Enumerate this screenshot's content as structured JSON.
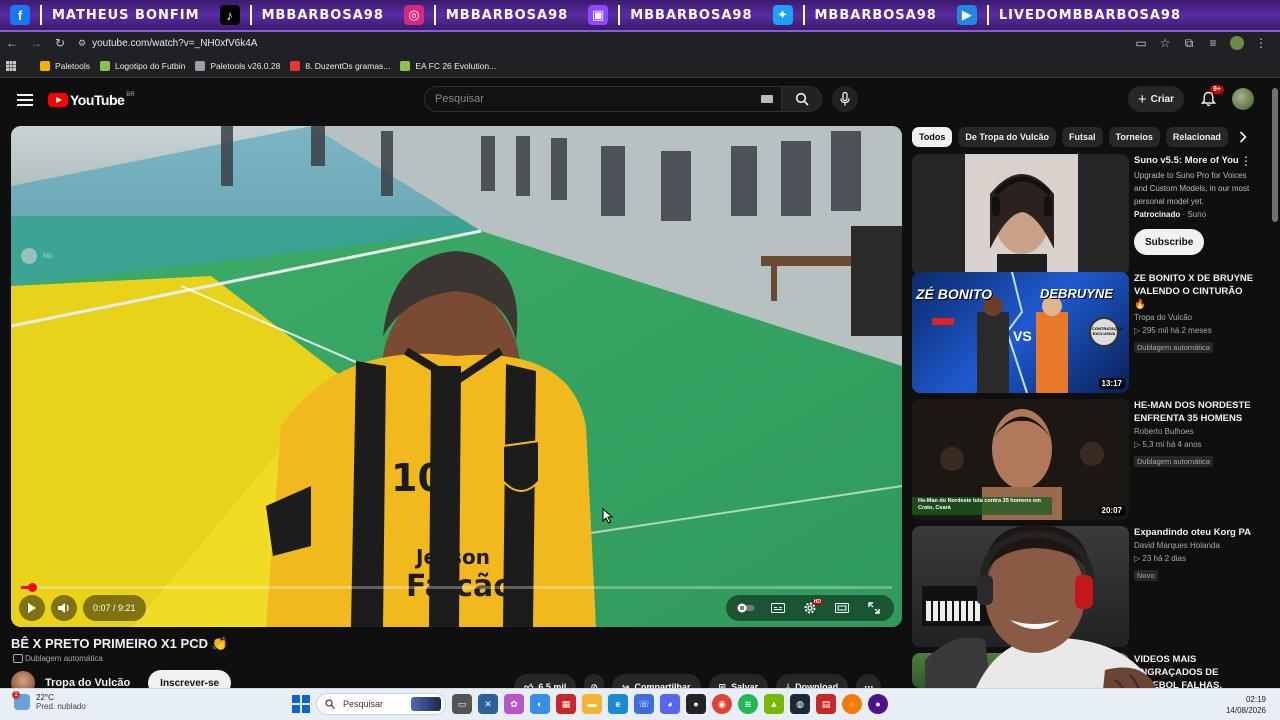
{
  "social": [
    {
      "icon": "facebook-icon",
      "glyph": "f",
      "color": "#1877f2",
      "label": "MATHEUS BONFIM"
    },
    {
      "icon": "tiktok-icon",
      "glyph": "♪",
      "color": "#000000",
      "label": "MBBARBOSA98"
    },
    {
      "icon": "instagram-icon",
      "glyph": "◎",
      "color": "#d6297e",
      "label": "MBBARBOSA98"
    },
    {
      "icon": "twitch-icon",
      "glyph": "▣",
      "color": "#9146ff",
      "label": "MBBARBOSA98"
    },
    {
      "icon": "twitter-icon",
      "glyph": "✦",
      "color": "#1da1f2",
      "label": "MBBARBOSA98"
    },
    {
      "icon": "youtube-icon",
      "glyph": "▶",
      "color": "#1e88e5",
      "label": "LIVEDOMBBARBOSA98"
    }
  ],
  "browser": {
    "url": "youtube.com/watch?v=_NH0xfV6k4A",
    "bookmarks": [
      {
        "label": "Paletools",
        "color": "#f4b400"
      },
      {
        "label": "Logotipo do Futbin",
        "color": "#8bc34a"
      },
      {
        "label": "Paletools v26.0.28",
        "color": "#9aa0a6"
      },
      {
        "label": "8. DuzentOs gramas...",
        "color": "#e53935"
      },
      {
        "label": "EA FC 26 Evolution...",
        "color": "#8bc34a"
      }
    ]
  },
  "header": {
    "logo": "YouTube",
    "region": "BR",
    "search_placeholder": "Pesquisar",
    "create_label": "Criar",
    "notif_count": "9+"
  },
  "player": {
    "time": "0:07 / 9:21",
    "progress": 0.0125,
    "watermark": "Mb",
    "jersey_number": "10",
    "sponsor_line1": "Jeyson",
    "sponsor_line2": "Falcão"
  },
  "video": {
    "title": "BÊ X PRETO PRIMEIRO X1 PCD 👏",
    "dub": "Dublagem automática",
    "channel": "Tropa do Vulcão",
    "subscribe": "Inscrever-se",
    "likes": "6,5 mil",
    "share": "Compartilhar",
    "save": "Salvar",
    "download": "Download"
  },
  "chips": [
    "Todos",
    "De Tropa do Vulcão",
    "Futsal",
    "Torneios",
    "Relacionad"
  ],
  "sidebar": {
    "ad": {
      "title": "Suno v5.5: More of You",
      "desc": "Upgrade to Suno Pro for Voices and Custom Models, in our most personal model yet.",
      "sponsored": "Patrocinado",
      "advertiser": "Suno",
      "cta": "Subscribe"
    },
    "videos": [
      {
        "title": "ZE BONITO X DE BRUYNE VALENDO O CINTURÃO 🔥",
        "channel": "Tropa do Vulcão",
        "stats": "295 mil  há 2 meses",
        "badge": "Dublagem automática",
        "duration": "13:17",
        "thumb_left": "ZÉ BONITO",
        "thumb_right": "DEBRUYNE",
        "thumb_tag": "CONTRATAÇÃO EXCLUSIVA"
      },
      {
        "title": "HE-MAN DOS NORDESTE ENFRENTA 35 HOMENS",
        "channel": "Roberto Bulhoes",
        "stats": "5,3 mi  há 4 anos",
        "badge": "Dublagem automática",
        "duration": "20:07",
        "caption": "He-Man do Nordeste luta contra 35 homens em Crato, Ceará"
      },
      {
        "title": "Expandindo oteu Korg PA",
        "channel": "David Marques Holanda",
        "stats": "23  há 2 dias",
        "badge": "Novo"
      },
      {
        "title": "VIDEOS MAIS ENGRAÇADOS DE FUTEBOL FALHAS, DRIBLES"
      }
    ]
  },
  "taskbar": {
    "temp": "22°C",
    "weather": "Pred. nublado",
    "search": "Pesquisar",
    "time": "02:19",
    "date": "14/08/2026"
  }
}
